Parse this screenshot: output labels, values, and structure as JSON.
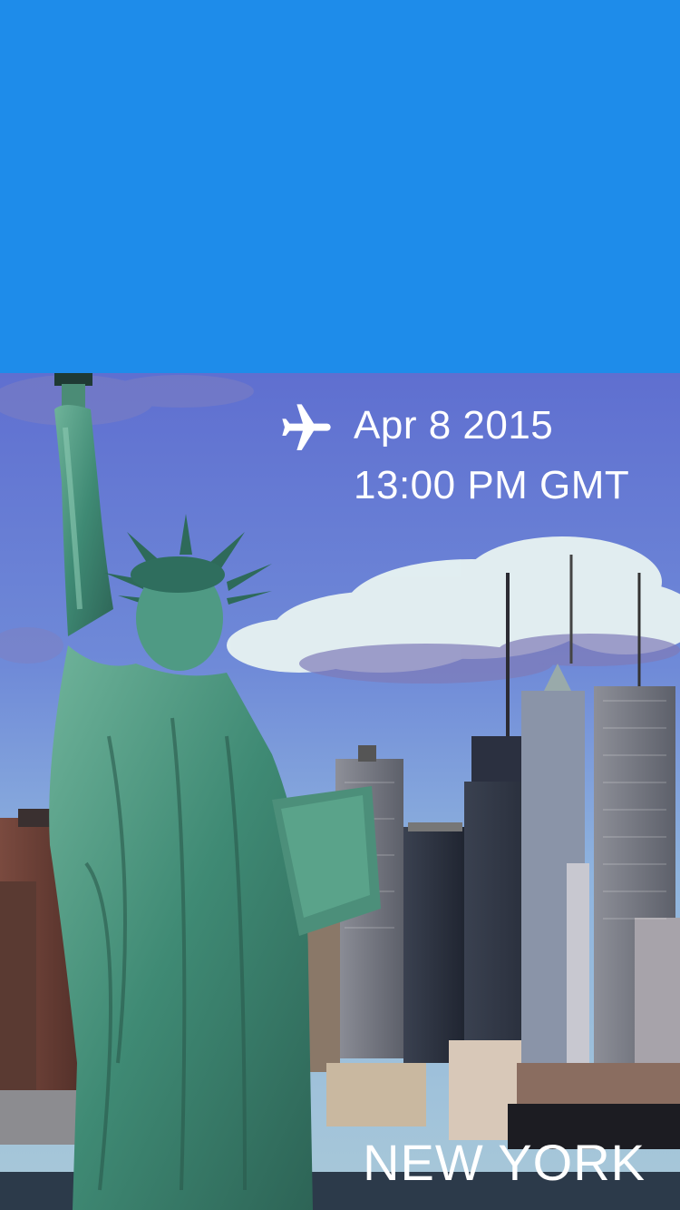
{
  "header": {
    "background_color": "#1E8CEA"
  },
  "flight": {
    "icon": "airplane-icon",
    "date": "Apr 8 2015",
    "time": "13:00 PM GMT"
  },
  "destination": {
    "city": "NEW YORK"
  },
  "photo": {
    "subject": "statue-of-liberty-skyline"
  }
}
